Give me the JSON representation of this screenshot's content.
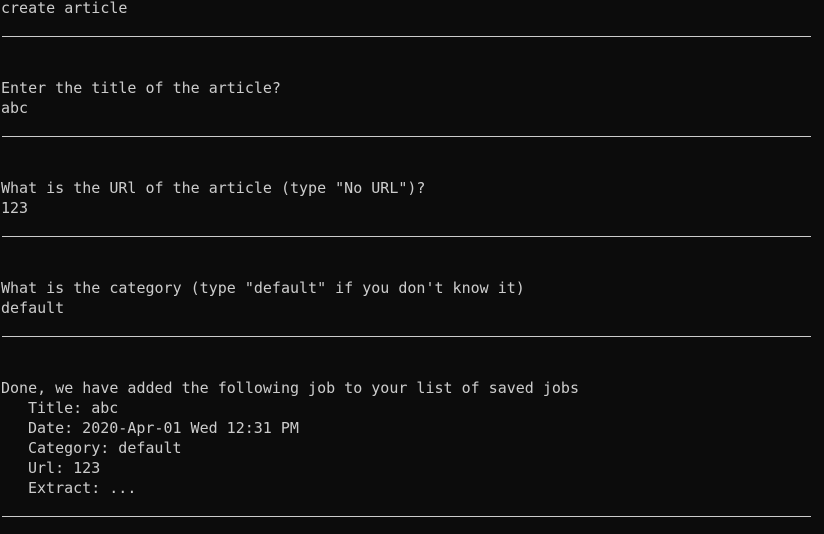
{
  "header": {
    "command": "create article"
  },
  "prompts": {
    "title_question": "Enter the title of the article?",
    "title_answer": "abc",
    "url_question": "What is the URl of the article (type \"No URL\")?",
    "url_answer": "123",
    "category_question": "What is the category (type \"default\" if you don't know it)",
    "category_answer": "default"
  },
  "summary": {
    "message": "Done, we have added the following job to your list of saved jobs",
    "title": "Title: abc",
    "date": "Date: 2020-Apr-01 Wed 12:31 PM",
    "category": "Category: default",
    "url": "Url: 123",
    "extract": "Extract: ..."
  },
  "colors": {
    "background": "#0c0c0c",
    "text": "#cccccc"
  }
}
